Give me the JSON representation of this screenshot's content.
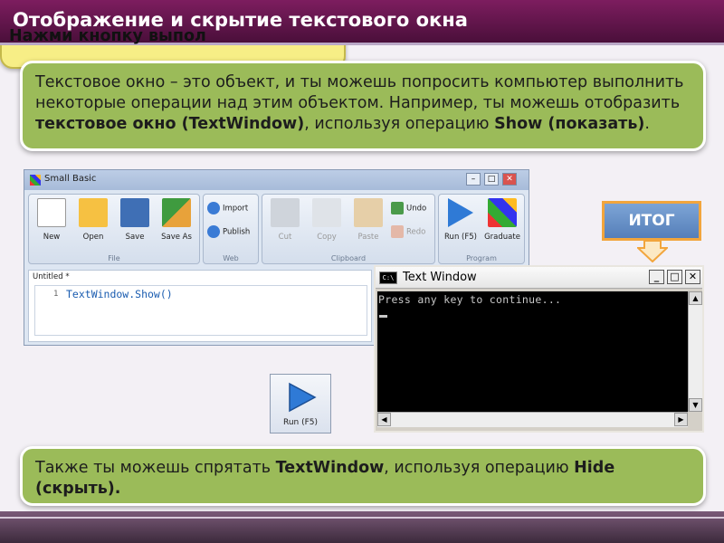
{
  "slide_title": "Отображение и скрытие текстового окна",
  "box1": {
    "t1": "Текстовое окно – это объект, и ты можешь попросить компьютер выполнить некоторые операции над этим объектом. Например, ты можешь отобразить ",
    "b1": "текстовое окно (TextWindow)",
    "t2": ", используя операцию ",
    "b2": "Show (показать)",
    "t3": "."
  },
  "box2": {
    "text": "Нажми кнопку выпол"
  },
  "box3": {
    "t1": "Также ты можешь спрятать ",
    "b1": "TextWindow",
    "t2": ", используя операцию ",
    "b2": "Hide (скрыть)."
  },
  "callout": {
    "label": "ИТОГ"
  },
  "small_basic": {
    "title": "Small Basic",
    "groups": {
      "file": {
        "label": "File",
        "buttons": [
          "New",
          "Open",
          "Save",
          "Save As"
        ]
      },
      "web": {
        "label": "Web",
        "buttons": [
          "Import",
          "Publish"
        ]
      },
      "clipboard": {
        "label": "Clipboard",
        "buttons": [
          "Cut",
          "Copy",
          "Paste",
          "Undo",
          "Redo"
        ]
      },
      "program": {
        "label": "Program",
        "buttons": [
          "Run (F5)",
          "Graduate"
        ]
      }
    },
    "doc_tab": "Untitled *",
    "line_number": "1",
    "code": "TextWindow.Show()"
  },
  "text_window": {
    "title": "Text Window",
    "icon_text": "C:\\",
    "output": "Press any key to continue..."
  },
  "run_button": {
    "label": "Run (F5)"
  }
}
